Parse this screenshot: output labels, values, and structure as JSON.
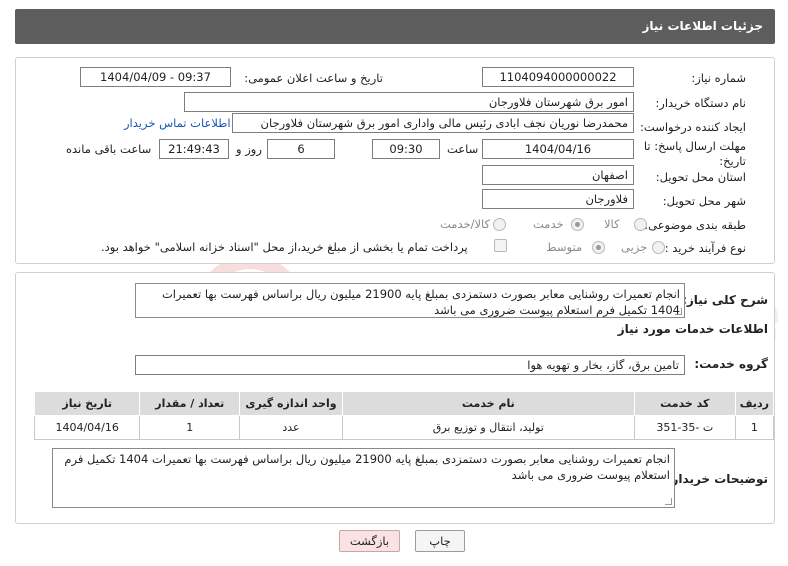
{
  "header": {
    "title": "جزئیات اطلاعات نیاز"
  },
  "info": {
    "need_number_label": "شماره نیاز:",
    "need_number": "1104094000000022",
    "announce_label": "تاریخ و ساعت اعلان عمومی:",
    "announce_value": "1404/04/09 - 09:37",
    "buyer_org_label": "نام دستگاه خریدار:",
    "buyer_org": "امور برق شهرستان فلاورجان",
    "creator_label": "ایجاد کننده درخواست:",
    "creator": "محمدرضا نوریان نجف ابادی رئیس مالی واداری  امور برق شهرستان فلاورجان",
    "contact_link": "اطلاعات تماس خریدار",
    "deadline_label": "مهلت ارسال پاسخ: تا تاریخ:",
    "deadline_date": "1404/04/16",
    "time_label": "ساعت",
    "deadline_time": "09:30",
    "days_value": "6",
    "days_label": "روز و",
    "remaining_time": "21:49:43",
    "remaining_label": "ساعت باقی مانده",
    "province_label": "استان محل تحویل:",
    "province": "اصفهان",
    "city_label": "شهر محل تحویل:",
    "city": "فلاورجان",
    "category_label": "طبقه بندی موضوعی:",
    "category_options": [
      "کالا",
      "خدمت",
      "کالا/خدمت"
    ],
    "category_selected": "خدمت",
    "process_label": "نوع فرآیند خرید :",
    "process_options": [
      "جزیی",
      "متوسط"
    ],
    "process_selected": "متوسط",
    "payment_note": "پرداخت تمام یا بخشی از مبلغ خرید،از محل \"اسناد خزانه اسلامی\" خواهد بود."
  },
  "summary": {
    "label": "شرح کلی نیاز:",
    "text": "انجام تعمیرات روشنایی معابر بصورت دستمزدی بمبلغ پایه 21900 میلیون ریال براساس فهرست بها تعمیرات 1404 تکمیل فرم استعلام پیوست ضروری می باشد"
  },
  "services": {
    "section_title": "اطلاعات خدمات مورد نیاز",
    "group_label": "گروه خدمت:",
    "group_value": "تامین برق، گاز، بخار و تهویه هوا",
    "columns": [
      "ردیف",
      "کد خدمت",
      "نام خدمت",
      "واحد اندازه گیری",
      "تعداد / مقدار",
      "تاریخ نیاز"
    ],
    "rows": [
      [
        "1",
        "ت -35-351",
        "تولید، انتقال و توزیع برق",
        "عدد",
        "1",
        "1404/04/16"
      ]
    ]
  },
  "buyer_notes": {
    "label": "توضیحات خریدار:",
    "text": "انجام تعمیرات روشنایی معابر بصورت دستمزدی بمبلغ پایه 21900 میلیون ریال براساس فهرست بها تعمیرات 1404 تکمیل فرم استعلام پیوست ضروری می باشد"
  },
  "buttons": {
    "print": "چاپ",
    "back": "بازگشت"
  },
  "watermark": {
    "text": "AriaTender.neT"
  },
  "colors": {
    "header_bg": "#5d5d5d",
    "link": "#1a56b8",
    "back_button_bg": "#fbe2e2",
    "table_header_bg": "#dcdcdc"
  }
}
